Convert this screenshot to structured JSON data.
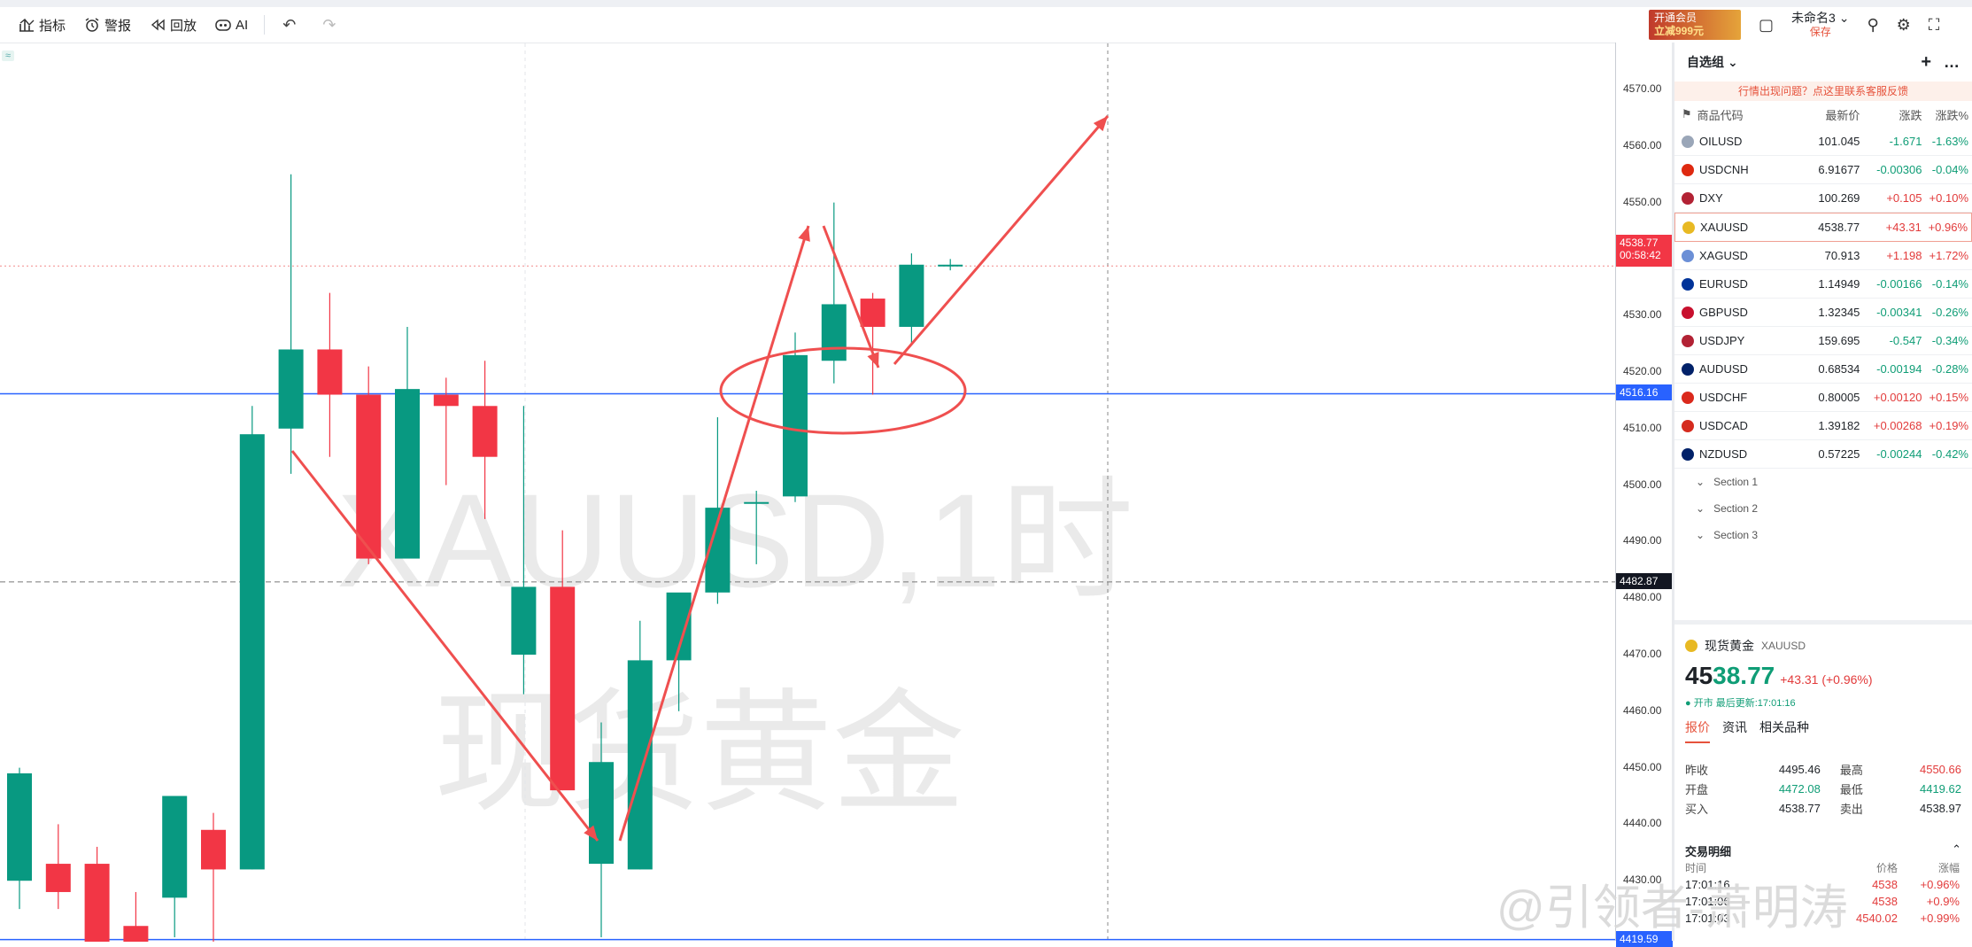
{
  "toolbar": {
    "indicators": "指标",
    "alert": "警报",
    "replay": "回放",
    "ai": "AI",
    "undo": "↶",
    "redo": "↷"
  },
  "topright": {
    "ad_line1": "开通会员",
    "ad_line2": "立减999元",
    "layout_name": "未命名3",
    "layout_save": "保存"
  },
  "chart": {
    "watermark_symbol": "XAUUSD,1时",
    "watermark_name": "现货黄金",
    "pane_badge": "≈"
  },
  "chart_data": {
    "type": "candlestick",
    "title": "XAUUSD,1时",
    "symbol": "XAUUSD",
    "ylim": [
      4417,
      4575
    ],
    "y_ticks": [
      4570,
      4560,
      4550,
      4540,
      4530,
      4520,
      4510,
      4500,
      4490,
      4480,
      4470,
      4460,
      4450,
      4440,
      4430
    ],
    "y_tick_labels": [
      "4570.00",
      "4560.00",
      "4550.00",
      "4540.00",
      "4530.00",
      "4520.00",
      "4510.00",
      "4500.00",
      "4490.00",
      "4480.00",
      "4470.00",
      "4460.00",
      "4450.00",
      "4440.00",
      "4430.00"
    ],
    "candles": [
      {
        "o": 4430,
        "h": 4450,
        "l": 4425,
        "c": 4449
      },
      {
        "o": 4433,
        "h": 4440,
        "l": 4425,
        "c": 4428
      },
      {
        "o": 4433,
        "h": 4436,
        "l": 4418,
        "c": 4419
      },
      {
        "o": 4422,
        "h": 4428,
        "l": 4416,
        "c": 4417
      },
      {
        "o": 4427,
        "h": 4445,
        "l": 4420,
        "c": 4445
      },
      {
        "o": 4439,
        "h": 4442,
        "l": 4419,
        "c": 4432
      },
      {
        "o": 4432,
        "h": 4514,
        "l": 4432,
        "c": 4509
      },
      {
        "o": 4510,
        "h": 4555,
        "l": 4502,
        "c": 4524
      },
      {
        "o": 4524,
        "h": 4534,
        "l": 4505,
        "c": 4516
      },
      {
        "o": 4516,
        "h": 4521,
        "l": 4486,
        "c": 4487
      },
      {
        "o": 4487,
        "h": 4528,
        "l": 4487,
        "c": 4517
      },
      {
        "o": 4516,
        "h": 4519,
        "l": 4500,
        "c": 4514
      },
      {
        "o": 4514,
        "h": 4522,
        "l": 4494,
        "c": 4505
      },
      {
        "o": 4470,
        "h": 4514,
        "l": 4463,
        "c": 4482
      },
      {
        "o": 4482,
        "h": 4492,
        "l": 4446,
        "c": 4446
      },
      {
        "o": 4433,
        "h": 4458,
        "l": 4420,
        "c": 4451
      },
      {
        "o": 4432,
        "h": 4476,
        "l": 4432,
        "c": 4469
      },
      {
        "o": 4469,
        "h": 4479,
        "l": 4460,
        "c": 4481
      },
      {
        "o": 4481,
        "h": 4512,
        "l": 4479,
        "c": 4496
      },
      {
        "o": 4497,
        "h": 4499,
        "l": 4486,
        "c": 4497
      },
      {
        "o": 4498,
        "h": 4527,
        "l": 4497,
        "c": 4523
      },
      {
        "o": 4522,
        "h": 4550,
        "l": 4518,
        "c": 4532
      },
      {
        "o": 4533,
        "h": 4534,
        "l": 4516,
        "c": 4528
      },
      {
        "o": 4528,
        "h": 4541,
        "l": 4525,
        "c": 4539
      },
      {
        "o": 4539,
        "h": 4540,
        "l": 4538,
        "c": 4539
      }
    ],
    "horizontal_lines": [
      4516.16,
      4419.59
    ],
    "current_price_line": 4538.77,
    "crosshair_price": 4482.87
  },
  "yaxis_tags": {
    "current_price": "4538.77",
    "countdown": "00:58:42",
    "level1": "4516.16",
    "crosshair": "4482.87",
    "level2": "4419.59"
  },
  "watchlist": {
    "title": "自选组",
    "add_icon": "+",
    "more_icon": "…",
    "notice": "行情出现问题？点这里联系客服反馈",
    "columns": {
      "symbol": "商品代码",
      "last": "最新价",
      "change": "涨跌",
      "pct": "涨跌%"
    },
    "rows": [
      {
        "symbol": "OILUSD",
        "last": "101.045",
        "change": "-1.671",
        "pct": "-1.63%",
        "dir": "dn",
        "flag": "#9aa6b8"
      },
      {
        "symbol": "USDCNH",
        "last": "6.91677",
        "change": "-0.00306",
        "pct": "-0.04%",
        "dir": "dn",
        "flag": "#de2910"
      },
      {
        "symbol": "DXY",
        "last": "100.269",
        "change": "+0.105",
        "pct": "+0.10%",
        "dir": "up",
        "flag": "#b22234"
      },
      {
        "symbol": "XAUUSD",
        "last": "4538.77",
        "change": "+43.31",
        "pct": "+0.96%",
        "dir": "up",
        "flag": "#e8b923"
      },
      {
        "symbol": "XAGUSD",
        "last": "70.913",
        "change": "+1.198",
        "pct": "+1.72%",
        "dir": "up",
        "flag": "#6b8fd6"
      },
      {
        "symbol": "EURUSD",
        "last": "1.14949",
        "change": "-0.00166",
        "pct": "-0.14%",
        "dir": "dn",
        "flag": "#003399"
      },
      {
        "symbol": "GBPUSD",
        "last": "1.32345",
        "change": "-0.00341",
        "pct": "-0.26%",
        "dir": "dn",
        "flag": "#c8102e"
      },
      {
        "symbol": "USDJPY",
        "last": "159.695",
        "change": "-0.547",
        "pct": "-0.34%",
        "dir": "dn",
        "flag": "#b22234"
      },
      {
        "symbol": "AUDUSD",
        "last": "0.68534",
        "change": "-0.00194",
        "pct": "-0.28%",
        "dir": "dn",
        "flag": "#012169"
      },
      {
        "symbol": "USDCHF",
        "last": "0.80005",
        "change": "+0.00120",
        "pct": "+0.15%",
        "dir": "up",
        "flag": "#da291c"
      },
      {
        "symbol": "USDCAD",
        "last": "1.39182",
        "change": "+0.00268",
        "pct": "+0.19%",
        "dir": "up",
        "flag": "#d52b1e"
      },
      {
        "symbol": "NZDUSD",
        "last": "0.57225",
        "change": "-0.00244",
        "pct": "-0.42%",
        "dir": "dn",
        "flag": "#012169"
      }
    ],
    "sections": [
      "Section 1",
      "Section 2",
      "Section 3"
    ]
  },
  "detail": {
    "name": "现货黄金",
    "symbol": "XAUUSD",
    "price_int": "45",
    "price_dec": "38.77",
    "change": "+43.31 (+0.96%)",
    "status": "● 开市 最后更新:17:01:16",
    "tabs": [
      "报价",
      "资讯",
      "相关品种"
    ],
    "quote": [
      {
        "k1": "昨收",
        "v1": "4495.46",
        "k2": "最高",
        "v2": "4550.66",
        "c1": "",
        "c2": "up"
      },
      {
        "k1": "开盘",
        "v1": "4472.08",
        "k2": "最低",
        "v2": "4419.62",
        "c1": "dn",
        "c2": "dn"
      },
      {
        "k1": "买入",
        "v1": "4538.77",
        "k2": "卖出",
        "v2": "4538.97",
        "c1": "",
        "c2": ""
      }
    ],
    "trades_title": "交易明细",
    "trades_cols": {
      "time": "时间",
      "price": "价格",
      "pct": "涨幅"
    },
    "trades": [
      {
        "time": "17:01:16",
        "price": "4538",
        "pct": "+0.96%",
        "dir": "up"
      },
      {
        "time": "17:01:06",
        "price": "4538",
        "pct": "+0.9%",
        "dir": "up"
      },
      {
        "time": "17:01:03",
        "price": "4540.02",
        "pct": "+0.99%",
        "dir": "up"
      }
    ]
  },
  "overlay_watermark": "@引领者-萧明涛",
  "colors": {
    "up": "#f23645",
    "down": "#089981",
    "accent": "#e6533c",
    "hline": "#2962ff"
  }
}
